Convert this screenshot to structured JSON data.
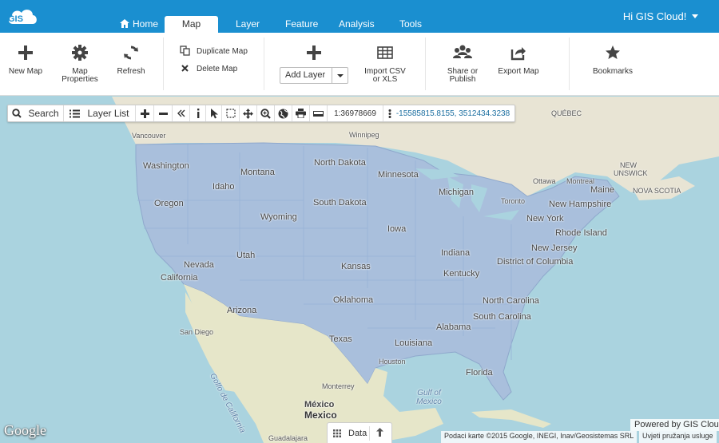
{
  "app": {
    "logo_text": "GIS",
    "user_greeting": "Hi GIS Cloud!"
  },
  "nav": {
    "tabs": [
      {
        "label": "Home"
      },
      {
        "label": "Map"
      },
      {
        "label": "Layer"
      },
      {
        "label": "Feature"
      },
      {
        "label": "Analysis"
      },
      {
        "label": "Tools"
      }
    ],
    "active_tab": "Map"
  },
  "ribbon": {
    "new_map": "New Map",
    "map_properties_1": "Map",
    "map_properties_2": "Properties",
    "refresh": "Refresh",
    "duplicate_map": "Duplicate Map",
    "delete_map": "Delete Map",
    "add_layer": "Add Layer",
    "import_1": "Import CSV",
    "import_2": "or XLS",
    "share_1": "Share or",
    "share_2": "Publish",
    "export_map": "Export Map",
    "bookmarks": "Bookmarks"
  },
  "map_toolbar": {
    "search": "Search",
    "layer_list": "Layer List",
    "scale": "1:36978669",
    "coordinates": "-15585815.8155, 3512434.3238"
  },
  "map_labels": {
    "states": [
      "Washington",
      "Montana",
      "North Dakota",
      "Minnesota",
      "Idaho",
      "Oregon",
      "Wyoming",
      "South Dakota",
      "Michigan",
      "Iowa",
      "Nevada",
      "Utah",
      "California",
      "Kansas",
      "Indiana",
      "Kentucky",
      "Arizona",
      "Oklahoma",
      "North Carolina",
      "South Carolina",
      "Alabama",
      "Texas",
      "Louisiana",
      "Florida",
      "New York",
      "New Hampshire",
      "Maine",
      "Rhode Island",
      "New Jersey",
      "District of Columbia"
    ],
    "cities": [
      "Vancouver",
      "Winnipeg",
      "Toronto",
      "Ottawa",
      "Montreal",
      "San Diego",
      "Houston",
      "Monterrey",
      "Guadalajara"
    ],
    "regions": [
      "QUÉBEC",
      "NEW",
      "UNSWICK",
      "NOVA SCOTIA",
      "México"
    ],
    "seas": [
      "Gulf of Mexico",
      "Golfo de California"
    ],
    "big": "Mexico"
  },
  "footer": {
    "google": "Google",
    "data_tab": "Data",
    "powered_by": "Powered by GIS Cloud",
    "attribution": "Podaci karte ©2015 Google, INEGI, Inav/Geosistemas SRL",
    "terms": "Uvjeti pružanja usluge"
  },
  "colors": {
    "brand_blue": "#1a8fd0",
    "water": "#aad3df",
    "land": "#efeadf",
    "usa_overlay": "#a9bfdc"
  }
}
